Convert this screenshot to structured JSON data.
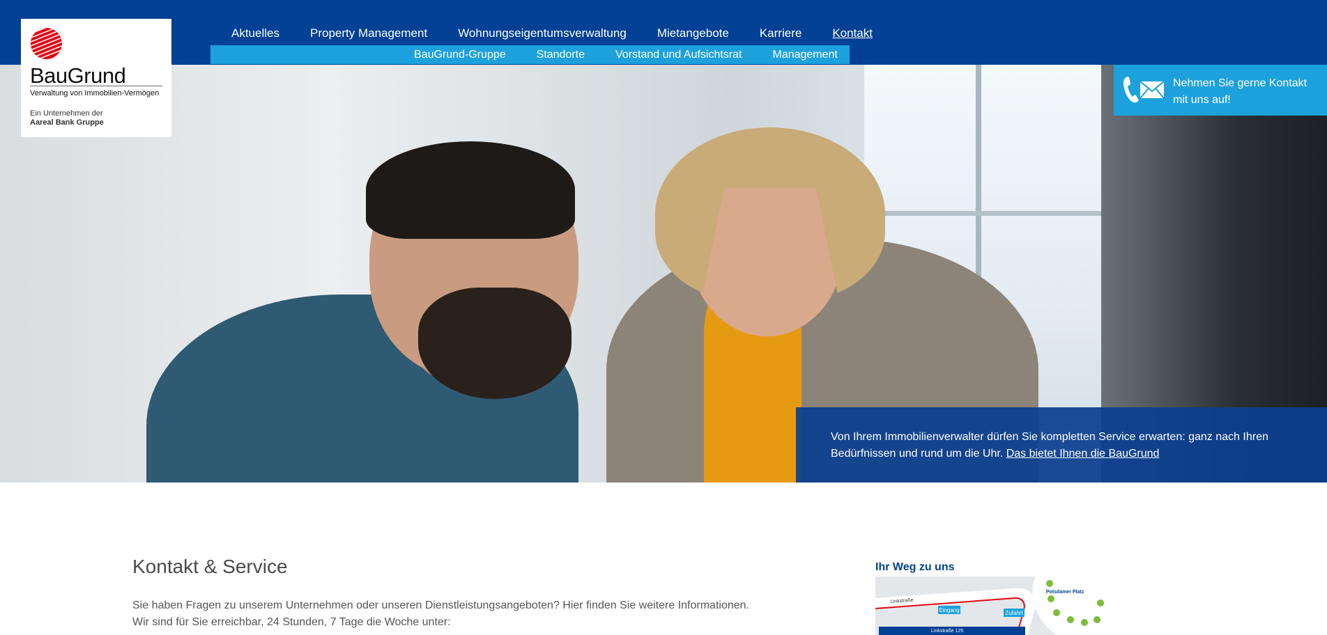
{
  "logo": {
    "name": "BauGrund",
    "tagline": "Verwaltung von Immobilien-Vermögen",
    "parent_line1": "Ein Unternehmen der",
    "parent_line2": "Aareal Bank Gruppe",
    "brand_red": "#e30613"
  },
  "nav": {
    "items": [
      {
        "label": "Aktuelles"
      },
      {
        "label": "Property Management"
      },
      {
        "label": "Wohnungseigentumsverwaltung"
      },
      {
        "label": "Mietangebote"
      },
      {
        "label": "Karriere"
      },
      {
        "label": "Kontakt"
      }
    ],
    "active": "Kontakt",
    "subitems": [
      {
        "label": "BauGrund-Gruppe"
      },
      {
        "label": "Standorte"
      },
      {
        "label": "Vorstand und Aufsichtsrat"
      },
      {
        "label": "Management"
      }
    ]
  },
  "contact_cta": {
    "text": "Nehmen Sie gerne Kontakt mit uns auf!",
    "icons": [
      "phone-icon",
      "mail-icon"
    ]
  },
  "hero": {
    "text": "Von Ihrem Immobilienverwalter dürfen Sie kompletten Service erwarten: ganz nach Ihren Bedürfnissen und rund um die Uhr.",
    "link_label": "Das bietet Ihnen die BauGrund"
  },
  "content": {
    "title": "Kontakt & Service",
    "paragraph1": "Sie haben Fragen zu unserem Unternehmen oder unseren Dienstleistungsangeboten? Hier finden Sie weitere Informationen.",
    "paragraph2": "Wir sind für Sie erreichbar, 24 Stunden, 7 Tage die Woche unter:"
  },
  "route": {
    "title": "Ihr Weg zu uns",
    "map_labels": {
      "street": "Linkstraße",
      "square": "Potsdamer Platz",
      "entrance": "Eingang",
      "driveway": "Zufahrt",
      "address": "Linkstraße 125"
    }
  },
  "colors": {
    "primary_blue": "#004095",
    "accent_cyan": "#1da1dc",
    "overlay_blue": "#0b408f"
  }
}
